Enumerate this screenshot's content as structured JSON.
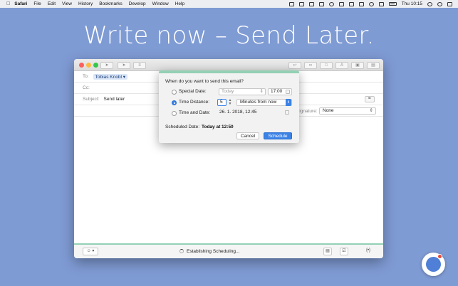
{
  "menubar": {
    "apple": "",
    "items": [
      "Safari",
      "File",
      "Edit",
      "View",
      "History",
      "Bookmarks",
      "Develop",
      "Window",
      "Help"
    ],
    "clock": "Thu 10:15"
  },
  "headline": "Write now – Send Later.",
  "compose": {
    "to_label": "To:",
    "to_recipient": "Tobias Knobl",
    "cc_label": "Cc:",
    "subject_label": "Subject:",
    "subject_value": "Send later",
    "signature_label": "Signature:",
    "signature_value": "None"
  },
  "dialog": {
    "question": "When do you want to send this email?",
    "option_special_date": "Special Date:",
    "special_date_value": "Today",
    "special_time_value": "17:00",
    "option_time_distance": "Time Distance:",
    "time_distance_value": "5",
    "time_unit_value": "Minutes from now",
    "option_time_and_date": "Time and Date:",
    "time_and_date_value": "26.  1. 2018, 12:45",
    "scheduled_label": "Scheduled Date:",
    "scheduled_value": "Today at 12:50",
    "cancel_label": "Cancel",
    "schedule_label": "Schedule"
  },
  "statusbar": {
    "status_text": "Establishing Scheduling...",
    "braces_label": "{•}"
  },
  "colors": {
    "background": "#7f9bd4",
    "accent": "#3b82e6",
    "dialog_top": "#94d0b4"
  }
}
